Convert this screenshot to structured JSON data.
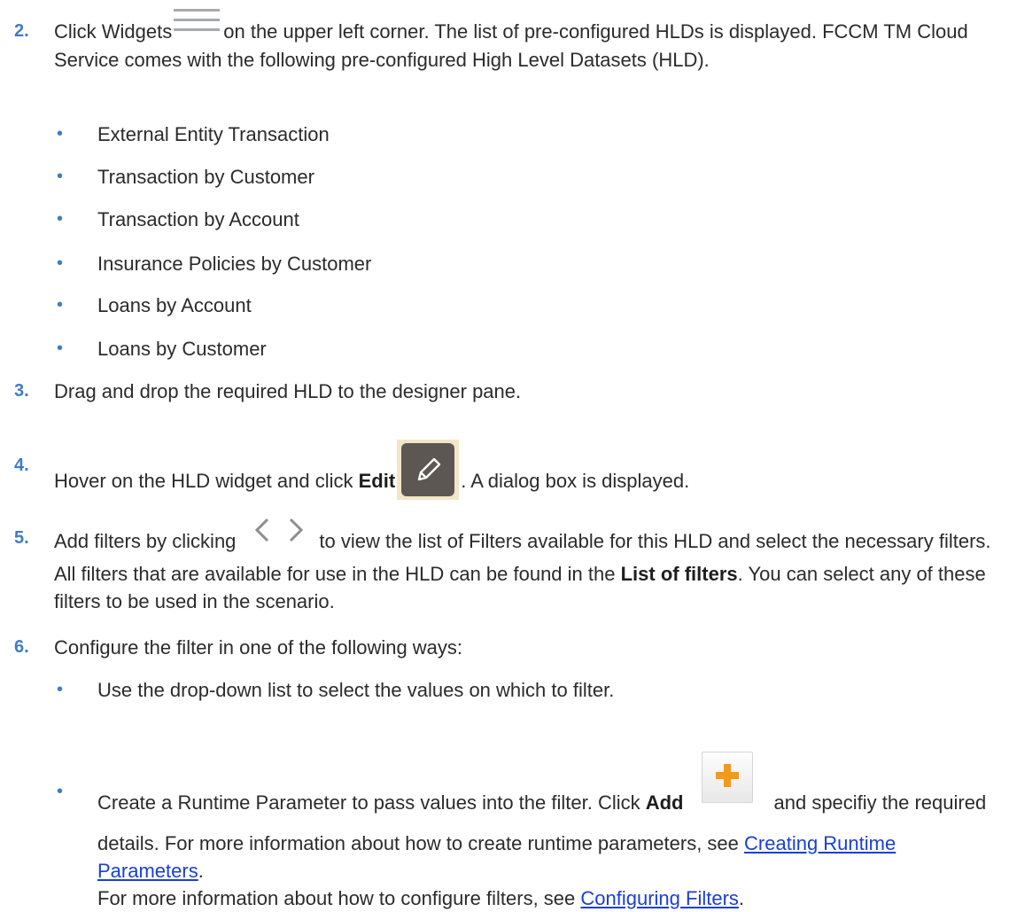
{
  "steps": [
    {
      "number": "2.",
      "text_before_icon": "Click Widgets",
      "text_after_icon": "on the upper left corner. The list of pre-configured HLDs is displayed. FCCM TM Cloud Service comes with the following pre-configured High Level Datasets (HLD).",
      "icon": "hamburger-menu-icon",
      "bullets": [
        "External Entity Transaction",
        "Transaction by Customer",
        "Transaction by Account",
        "Insurance Policies by Customer",
        "Loans by Account",
        "Loans by Customer"
      ]
    },
    {
      "number": "3.",
      "text": "Drag and drop the required HLD to the designer pane."
    },
    {
      "number": "4.",
      "text_before": "Hover on the HLD widget and click",
      "bold": "Edit",
      "text_after": ". A dialog box is displayed.",
      "icon": "pencil-edit-icon"
    },
    {
      "number": "5.",
      "text_before_icon": "Add filters by clicking",
      "text_after_icon": "to view the list of Filters available for this HLD and select the necessary filters. All filters that are available for use in the HLD can be found in the",
      "bold": "List of filters",
      "text_end": ". You can select any of these filters to be used in the scenario.",
      "icon": "code-brackets-icon"
    },
    {
      "number": "6.",
      "text": "Configure the filter in one of the following ways:",
      "bullets": [
        {
          "text": "Use the drop-down list to select the values on which to filter."
        },
        {
          "text_before": "Create a Runtime Parameter to pass values into the filter. Click",
          "bold": "Add",
          "text_after": "and specifiy the required details. For more information about how to create runtime parameters, see",
          "link": "Creating Runtime Parameters",
          "after_link": ".",
          "line2_before": "For more information about how to configure filters, see",
          "line2_link": "Configuring Filters",
          "line2_after": ".",
          "icon": "plus-add-icon"
        }
      ]
    }
  ],
  "colors": {
    "step_number": "#3f7cc4",
    "bullet": "#3f7cc4",
    "link": "#1a3fd6",
    "text": "#2b2b2b",
    "edit_icon_bg": "#5c5752",
    "add_icon_plus": "#f29a1c"
  }
}
